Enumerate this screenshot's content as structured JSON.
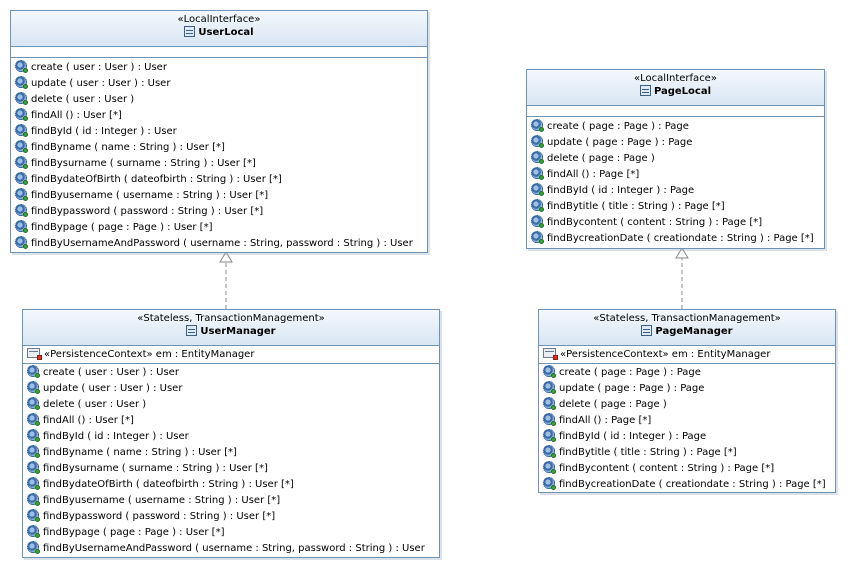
{
  "classes": {
    "user_local": {
      "stereotype": "«LocalInterface»",
      "name": "UserLocal",
      "operations": [
        "create ( user : User ) : User",
        "update ( user : User ) : User",
        "delete ( user : User )",
        "findAll () : User [*]",
        "findById ( id : Integer ) : User",
        "findByname ( name : String ) : User [*]",
        "findBysurname ( surname : String ) : User [*]",
        "findBydateOfBirth ( dateofbirth : String ) : User [*]",
        "findByusername ( username : String ) : User [*]",
        "findBypassword ( password : String ) : User [*]",
        "findBypage ( page : Page ) : User [*]",
        "findByUsernameAndPassword ( username : String, password : String ) : User"
      ]
    },
    "user_manager": {
      "stereotype": "«Stateless, TransactionManagement»",
      "name": "UserManager",
      "attribute": "«PersistenceContext» em : EntityManager",
      "operations": [
        "create ( user : User ) : User",
        "update ( user : User ) : User",
        "delete ( user : User )",
        "findAll () : User [*]",
        "findById ( id : Integer ) : User",
        "findByname ( name : String ) : User [*]",
        "findBysurname ( surname : String ) : User [*]",
        "findBydateOfBirth ( dateofbirth : String ) : User [*]",
        "findByusername ( username : String ) : User [*]",
        "findBypassword ( password : String ) : User [*]",
        "findBypage ( page : Page ) : User [*]",
        "findByUsernameAndPassword ( username : String, password : String ) : User"
      ]
    },
    "page_local": {
      "stereotype": "«LocalInterface»",
      "name": "PageLocal",
      "operations": [
        "create ( page : Page ) : Page",
        "update ( page : Page ) : Page",
        "delete ( page : Page )",
        "findAll () : Page [*]",
        "findById ( id : Integer ) : Page",
        "findBytitle ( title : String ) : Page [*]",
        "findBycontent ( content : String ) : Page [*]",
        "findBycreationDate ( creationdate : String ) : Page [*]"
      ]
    },
    "page_manager": {
      "stereotype": "«Stateless, TransactionManagement»",
      "name": "PageManager",
      "attribute": "«PersistenceContext» em : EntityManager",
      "operations": [
        "create ( page : Page ) : Page",
        "update ( page : Page ) : Page",
        "delete ( page : Page )",
        "findAll () : Page [*]",
        "findById ( id : Integer ) : Page",
        "findBytitle ( title : String ) : Page [*]",
        "findBycontent ( content : String ) : Page [*]",
        "findBycreationDate ( creationdate : String ) : Page [*]"
      ]
    }
  },
  "colors": {
    "border": "#6f93b5",
    "header_top": "#f3f8fd",
    "header_bottom": "#d8e6f3",
    "link": "#888888"
  }
}
